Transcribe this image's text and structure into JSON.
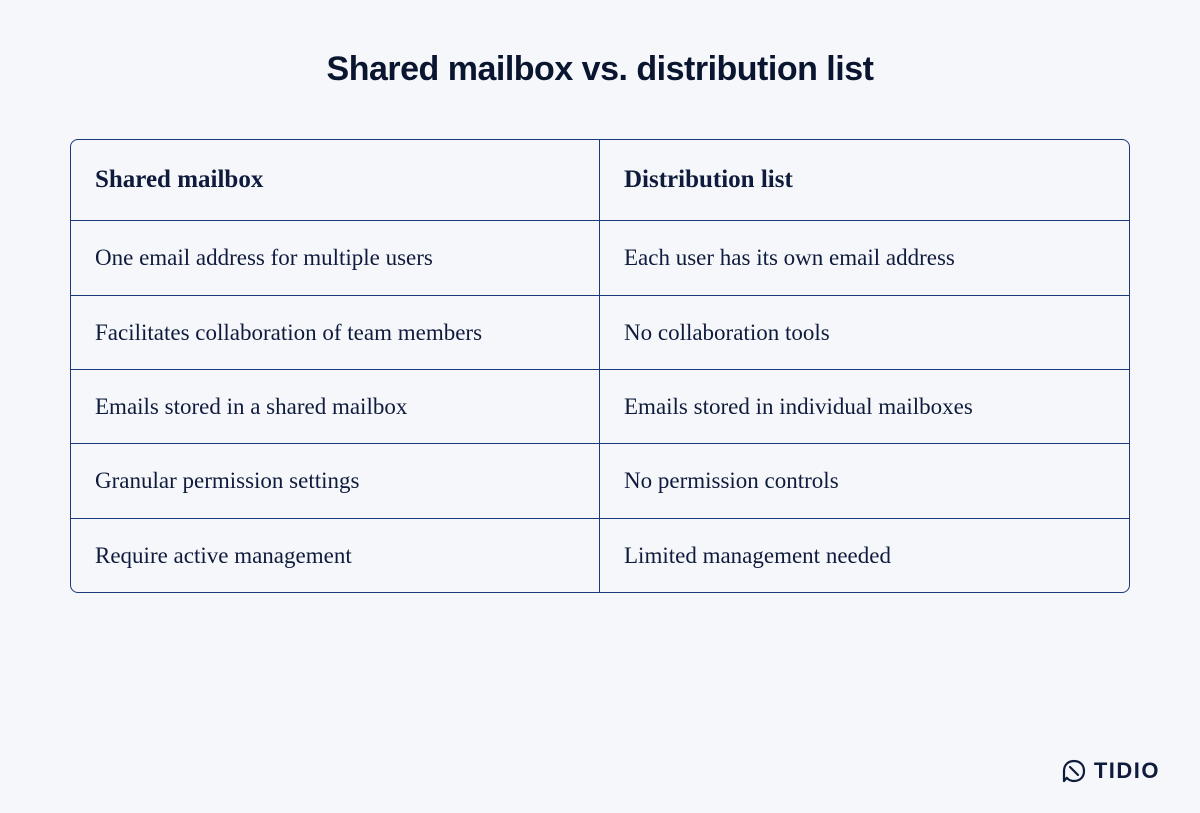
{
  "title": "Shared mailbox vs. distribution list",
  "table": {
    "headers": {
      "left": "Shared mailbox",
      "right": "Distribution list"
    },
    "rows": [
      {
        "left": "One email address for multiple users",
        "right": "Each user has its own email address"
      },
      {
        "left": "Facilitates collaboration of team members",
        "right": "No collaboration tools"
      },
      {
        "left": "Emails stored in a shared mailbox",
        "right": "Emails stored in individual mailboxes"
      },
      {
        "left": "Granular permission settings",
        "right": "No permission controls"
      },
      {
        "left": "Require active management",
        "right": "Limited management needed"
      }
    ]
  },
  "brand": {
    "name": "TIDIO"
  }
}
